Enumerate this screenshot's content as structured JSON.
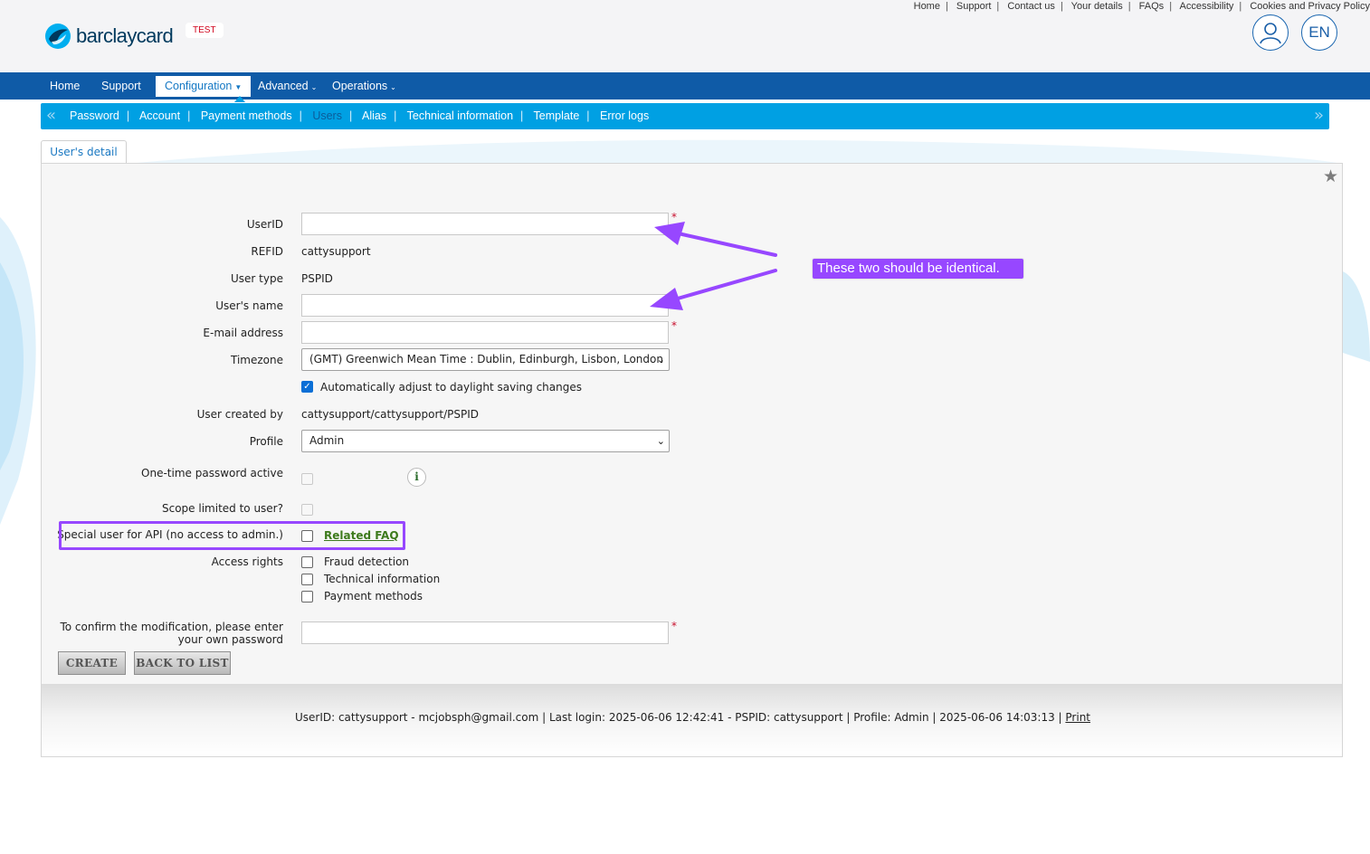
{
  "header": {
    "top_links": [
      "Home",
      "Support",
      "Contact us",
      "Your details",
      "FAQs",
      "Accessibility",
      "Cookies and Privacy Policy"
    ],
    "logo_text": "barclaycard",
    "env_badge": "TEST",
    "language": "EN"
  },
  "main_nav": {
    "items": [
      "Home",
      "Support",
      "Configuration",
      "Advanced",
      "Operations"
    ],
    "active": "Configuration"
  },
  "sub_nav": {
    "items": [
      "Password",
      "Account",
      "Payment methods",
      "Users",
      "Alias",
      "Technical information",
      "Template",
      "Error logs"
    ],
    "current": "Users"
  },
  "tab": {
    "label": "User's detail"
  },
  "form": {
    "userid_label": "UserID",
    "userid_value": "",
    "refid_label": "REFID",
    "refid_value": "cattysupport",
    "user_type_label": "User type",
    "user_type_value": "PSPID",
    "users_name_label": "User's name",
    "users_name_value": "",
    "email_label": "E-mail address",
    "email_value": "",
    "required_mark": "*",
    "timezone_label": "Timezone",
    "timezone_value": "(GMT) Greenwich Mean Time : Dublin, Edinburgh, Lisbon, London",
    "dst_label": "Automatically adjust to daylight saving changes",
    "dst_checked": true,
    "created_by_label": "User created by",
    "created_by_value": "cattysupport/cattysupport/PSPID",
    "profile_label": "Profile",
    "profile_value": "Admin",
    "otp_label": "One-time password active",
    "scope_label": "Scope limited to user?",
    "api_label": "Special user for API (no access to admin.)",
    "related_faq": "Related FAQ",
    "access_rights_label": "Access rights",
    "access_rights": [
      "Fraud detection",
      "Technical information",
      "Payment methods"
    ],
    "confirm_label_line1": "To confirm the modification, please enter",
    "confirm_label_line2": "your own password",
    "confirm_value": ""
  },
  "buttons": {
    "create": "CREATE",
    "back": "BACK TO LIST"
  },
  "footer": {
    "text": "UserID: cattysupport - mcjobsph@gmail.com | Last login: 2025-06-06 12:42:41 - PSPID: cattysupport | Profile: Admin | 2025-06-06 14:03:13 | ",
    "print": "Print"
  },
  "annotation": {
    "note": "These two should be identical.",
    "color": "#9747ff"
  },
  "colors": {
    "main_nav": "#0f5ba7",
    "sub_nav": "#00a0e3",
    "accent": "#9747ff"
  }
}
